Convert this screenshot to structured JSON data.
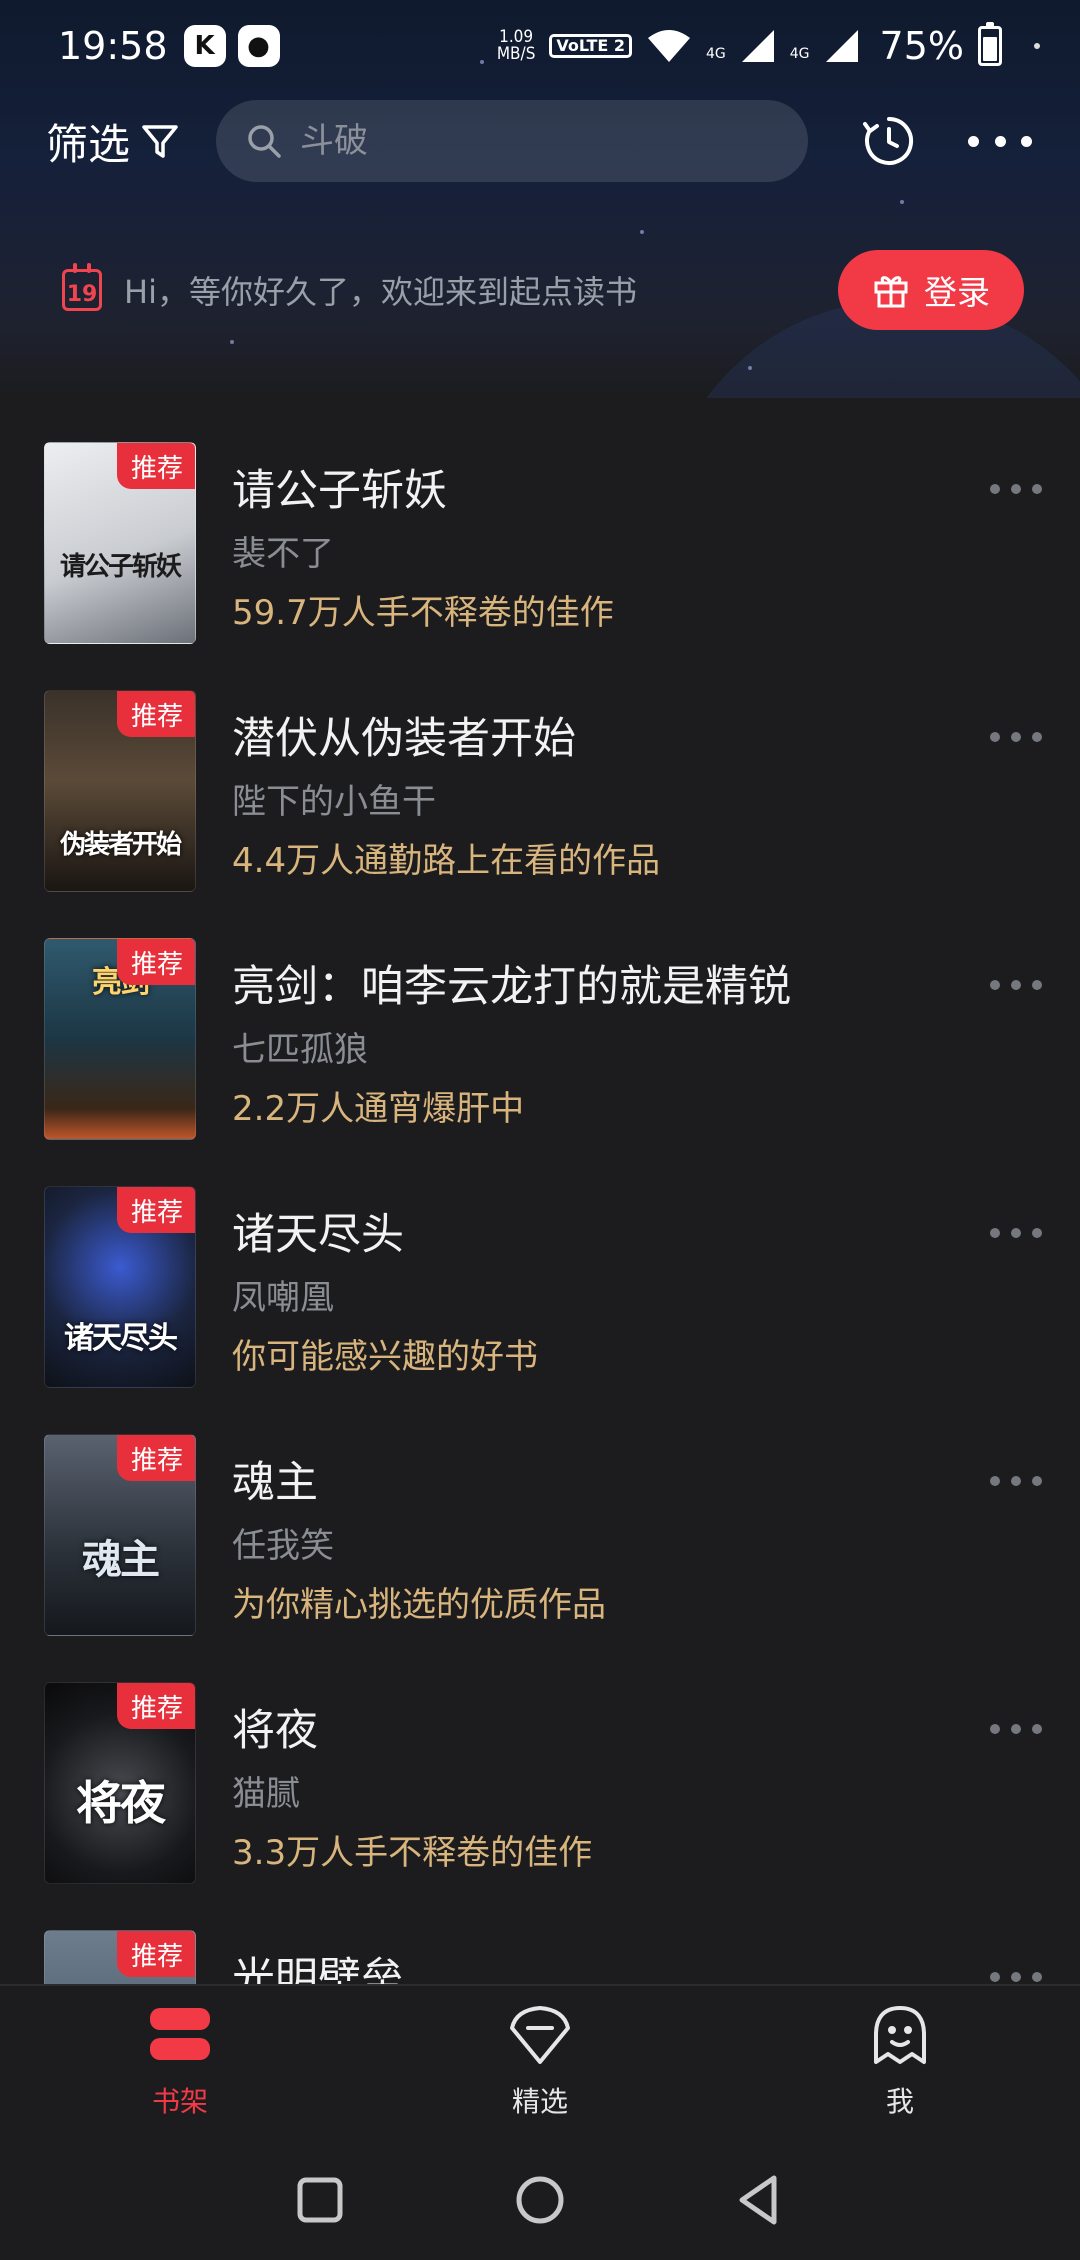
{
  "status_bar": {
    "time": "19:58",
    "net_speed_value": "1.09",
    "net_speed_unit": "MB/S",
    "volte": "VoLTE 2",
    "signal_labels": [
      "4G",
      "4G"
    ],
    "battery": "75%",
    "icons": [
      "kuaishou-app-icon",
      "message-app-icon",
      "wifi-icon",
      "signal-icon",
      "battery-icon"
    ]
  },
  "header": {
    "filter_label": "筛选",
    "search_placeholder": "斗破",
    "history_icon": "history-clock-icon",
    "more_icon": "more-dots-icon"
  },
  "welcome": {
    "calendar_day": "19",
    "text": "Hi，等你好久了，欢迎来到起点读书",
    "login_label": "登录"
  },
  "books": [
    {
      "title": "请公子斩妖",
      "author": "裴不了",
      "desc": "59.7万人手不释卷的佳作",
      "tag": "推荐",
      "cover_text": "请公子斩妖",
      "cover_bg": "#d8d9dc",
      "cover_fg": "#222"
    },
    {
      "title": "潜伏从伪装者开始",
      "author": "陛下的小鱼干",
      "desc": "4.4万人通勤路上在看的作品",
      "tag": "推荐",
      "cover_text": "伪装者开始",
      "cover_bg": "#2b2621",
      "cover_fg": "#fff"
    },
    {
      "title": "亮剑：咱李云龙打的就是精锐",
      "author": "七匹孤狼",
      "desc": "2.2万人通宵爆肝中",
      "tag": "推荐",
      "cover_text": "亮剑",
      "cover_bg": "#1f3b4a",
      "cover_fg": "#ffd36b"
    },
    {
      "title": "诸天尽头",
      "author": "凤嘲凰",
      "desc": "你可能感兴趣的好书",
      "tag": "推荐",
      "cover_text": "诸天尽头",
      "cover_bg": "#1d2433",
      "cover_fg": "#fff"
    },
    {
      "title": "魂主",
      "author": "任我笑",
      "desc": "为你精心挑选的优质作品",
      "tag": "推荐",
      "cover_text": "魂主",
      "cover_bg": "#2a3038",
      "cover_fg": "#dfe7f0"
    },
    {
      "title": "将夜",
      "author": "猫腻",
      "desc": "3.3万人手不释卷的佳作",
      "tag": "推荐",
      "cover_text": "将夜",
      "cover_bg": "#111214",
      "cover_fg": "#fff"
    },
    {
      "title": "光明壁垒",
      "author": "",
      "desc": "",
      "tag": "推荐",
      "cover_text": "",
      "cover_bg": "#3a4a5a",
      "cover_fg": "#fff"
    }
  ],
  "bottom_nav": [
    {
      "label": "书架",
      "icon": "bookshelf-icon",
      "active": true
    },
    {
      "label": "精选",
      "icon": "diamond-icon",
      "active": false
    },
    {
      "label": "我",
      "icon": "profile-icon",
      "active": false
    }
  ],
  "system_nav": [
    "recents-square-icon",
    "home-circle-icon",
    "back-triangle-icon"
  ],
  "colors": {
    "accent": "#f23a47",
    "desc_gold": "#d9b57e",
    "author_gray": "#8a8d94",
    "background": "#1c1c1e"
  }
}
